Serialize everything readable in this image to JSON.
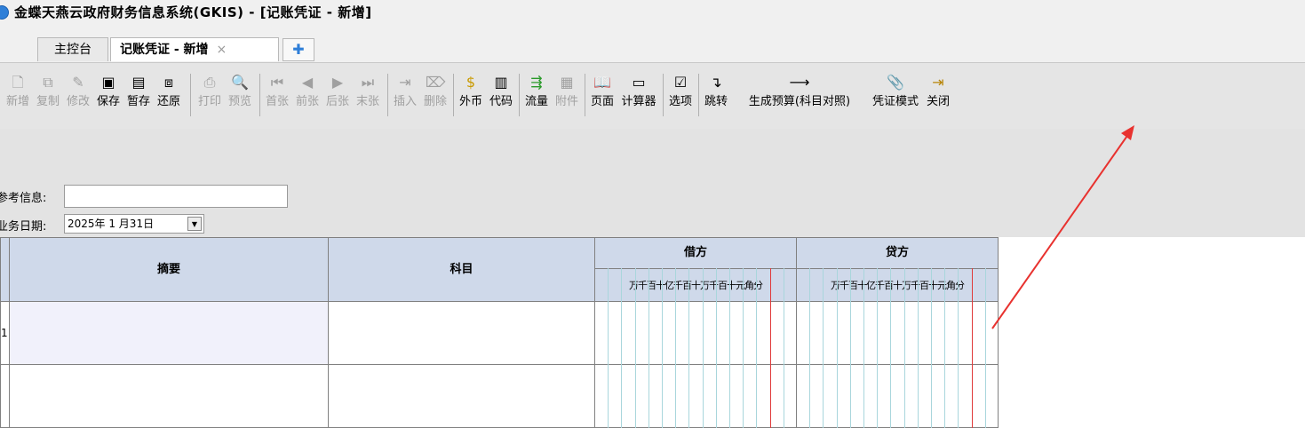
{
  "window": {
    "title": "金蝶天燕云政府财务信息系统(GKIS) - [记账凭证 - 新增]"
  },
  "tabs": [
    {
      "label": "主控台"
    },
    {
      "label": "记账凭证 - 新增",
      "close": "×"
    }
  ],
  "tab_add": "✚",
  "toolbar": {
    "buttons": [
      {
        "label": "新增",
        "icon": "new-doc-icon"
      },
      {
        "label": "复制",
        "icon": "copy-icon"
      },
      {
        "label": "修改",
        "icon": "edit-icon"
      },
      {
        "label": "保存",
        "icon": "save-icon"
      },
      {
        "label": "暂存",
        "icon": "temp-save-icon"
      },
      {
        "label": "还原",
        "icon": "restore-icon"
      },
      {
        "label": "打印",
        "icon": "print-icon"
      },
      {
        "label": "预览",
        "icon": "preview-icon"
      },
      {
        "label": "首张",
        "icon": "first-icon"
      },
      {
        "label": "前张",
        "icon": "prev-icon"
      },
      {
        "label": "后张",
        "icon": "next-icon"
      },
      {
        "label": "末张",
        "icon": "last-icon"
      },
      {
        "label": "插入",
        "icon": "insert-icon"
      },
      {
        "label": "删除",
        "icon": "delete-icon"
      },
      {
        "label": "外币",
        "icon": "currency-icon"
      },
      {
        "label": "代码",
        "icon": "code-icon"
      },
      {
        "label": "流量",
        "icon": "flow-icon"
      },
      {
        "label": "附件",
        "icon": "attachment-icon"
      },
      {
        "label": "页面",
        "icon": "page-icon"
      },
      {
        "label": "计算器",
        "icon": "calculator-icon"
      },
      {
        "label": "选项",
        "icon": "options-icon"
      },
      {
        "label": "跳转",
        "icon": "jump-icon"
      },
      {
        "label": "生成预算(科目对照)",
        "icon": "arrow-right-icon"
      },
      {
        "label": "凭证模式",
        "icon": "paperclip-icon"
      },
      {
        "label": "关闭",
        "icon": "exit-icon"
      }
    ]
  },
  "form": {
    "ref_label": "参考信息:",
    "ref_value": "",
    "date_label": "业务日期:",
    "date_value": "2025年 1 月31日"
  },
  "grid": {
    "col_summary": "摘要",
    "col_account": "科目",
    "col_debit": "借方",
    "col_credit": "贷方",
    "digit_units": "万千百十亿千百十万千百十元角分",
    "row_numbers": [
      "1",
      ""
    ]
  },
  "colors": {
    "annotation_arrow": "#e8322f",
    "header_bg": "#cfd9ea",
    "row_highlight": "#f1f1fb"
  }
}
